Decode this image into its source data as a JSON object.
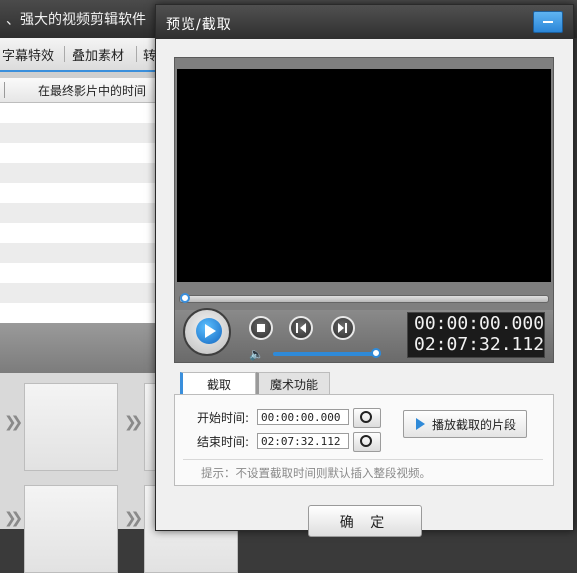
{
  "background_app": {
    "title": "、强大的视频剪辑软件",
    "tabs": [
      "字幕特效",
      "叠加素材",
      "转"
    ],
    "column_header": "在最终影片中的时间"
  },
  "dialog": {
    "title": "预览/截取",
    "player": {
      "current_time": "00:00:00.000",
      "total_time": "02:07:32.112",
      "seek_progress": 0.0,
      "volume_level": 0.95
    },
    "tabs": [
      {
        "label": "截取",
        "active": true
      },
      {
        "label": "魔术功能",
        "active": false
      }
    ],
    "capture": {
      "start_label": "开始时间:",
      "start_value": "00:00:00.000",
      "end_label": "结束时间:",
      "end_value": "02:07:32.112",
      "play_segment_label": "播放截取的片段",
      "tip": "提示：不设置截取时间则默认插入整段视频。"
    },
    "ok_label": "确 定"
  },
  "colors": {
    "accent_blue": "#2f8ad8",
    "titlebar_dark": "#2f2f2f",
    "video_black": "#000000"
  }
}
